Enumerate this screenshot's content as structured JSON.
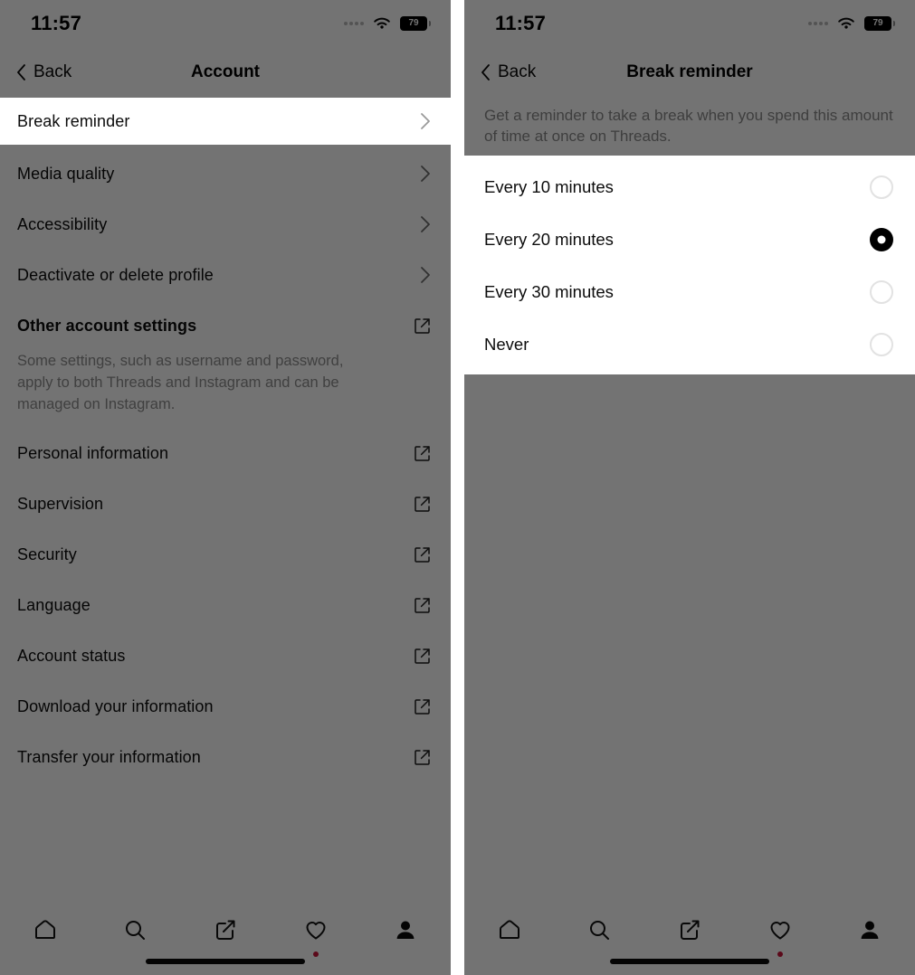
{
  "statusbar": {
    "time": "11:57",
    "battery_level": "79",
    "wifi_icon": "wifi-icon",
    "signal_icon": "signal-dots-icon",
    "battery_icon": "battery-icon"
  },
  "left_panel": {
    "nav": {
      "back_label": "Back",
      "title": "Account",
      "back_icon": "chevron-left-icon"
    },
    "highlighted_item": {
      "label": "Break reminder",
      "accessory_icon": "chevron-right-icon"
    },
    "items": [
      {
        "label": "Media quality",
        "accessory": "chevron",
        "icon": "chevron-right-icon",
        "bold": false
      },
      {
        "label": "Accessibility",
        "accessory": "chevron",
        "icon": "chevron-right-icon",
        "bold": false
      },
      {
        "label": "Deactivate or delete profile",
        "accessory": "chevron",
        "icon": "chevron-right-icon",
        "bold": false
      },
      {
        "label": "Other account settings",
        "accessory": "external",
        "icon": "external-link-icon",
        "bold": true
      }
    ],
    "note": "Some settings, such as username and password, apply to both Threads and Instagram and can be managed on Instagram.",
    "external_items": [
      {
        "label": "Personal information",
        "icon": "external-link-icon"
      },
      {
        "label": "Supervision",
        "icon": "external-link-icon"
      },
      {
        "label": "Security",
        "icon": "external-link-icon"
      },
      {
        "label": "Language",
        "icon": "external-link-icon"
      },
      {
        "label": "Account status",
        "icon": "external-link-icon"
      },
      {
        "label": "Download your information",
        "icon": "external-link-icon"
      },
      {
        "label": "Transfer your information",
        "icon": "external-link-icon"
      }
    ]
  },
  "right_panel": {
    "nav": {
      "back_label": "Back",
      "title": "Break reminder",
      "back_icon": "chevron-left-icon"
    },
    "description": "Get a reminder to take a break when you spend this amount of time at once on Threads.",
    "options": [
      {
        "label": "Every 10 minutes",
        "selected": false
      },
      {
        "label": "Every 20 minutes",
        "selected": true
      },
      {
        "label": "Every 30 minutes",
        "selected": false
      },
      {
        "label": "Never",
        "selected": false
      }
    ]
  },
  "tabbar": {
    "items": [
      {
        "name": "home-icon",
        "badge": false,
        "active": false
      },
      {
        "name": "search-icon",
        "badge": false,
        "active": false
      },
      {
        "name": "compose-icon",
        "badge": false,
        "active": false
      },
      {
        "name": "heart-icon",
        "badge": true,
        "active": false
      },
      {
        "name": "profile-icon",
        "badge": false,
        "active": true
      }
    ]
  },
  "colors": {
    "veil": "#000000",
    "card_background": "#ffffff",
    "notification_dot": "#c9143a",
    "selected_radio": "#000000",
    "unselected_radio_border": "#e2e2e2",
    "muted_text": "#8e8e8e",
    "primary_text": "#0c0c0c"
  }
}
